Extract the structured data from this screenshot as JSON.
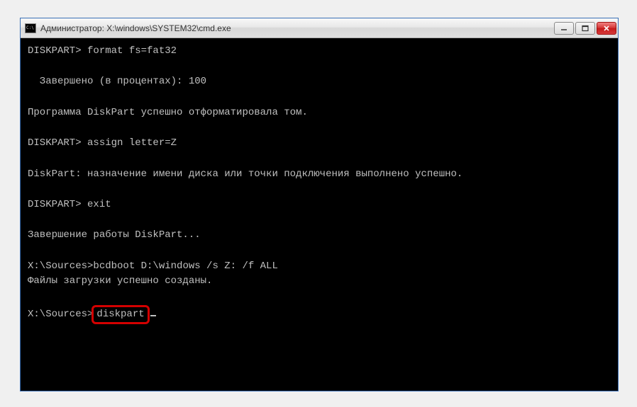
{
  "window": {
    "title": "Администратор: X:\\windows\\SYSTEM32\\cmd.exe"
  },
  "terminal": {
    "lines": [
      {
        "prompt": "DISKPART> ",
        "cmd": "format fs=fat32"
      },
      {
        "blank": true
      },
      {
        "text": "  Завершено (в процентах): 100"
      },
      {
        "blank": true
      },
      {
        "text": "Программа DiskPart успешно отформатировала том."
      },
      {
        "blank": true
      },
      {
        "prompt": "DISKPART> ",
        "cmd": "assign letter=Z"
      },
      {
        "blank": true
      },
      {
        "text": "DiskPart: назначение имени диска или точки подключения выполнено успешно."
      },
      {
        "blank": true
      },
      {
        "prompt": "DISKPART> ",
        "cmd": "exit"
      },
      {
        "blank": true
      },
      {
        "text": "Завершение работы DiskPart..."
      },
      {
        "blank": true
      },
      {
        "prompt": "X:\\Sources>",
        "cmd": "bcdboot D:\\windows /s Z: /f ALL"
      },
      {
        "text": "Файлы загрузки успешно созданы."
      },
      {
        "blank": true
      },
      {
        "prompt": "X:\\Sources>",
        "cmd": "diskpart",
        "highlighted": true,
        "cursor": true
      }
    ]
  }
}
